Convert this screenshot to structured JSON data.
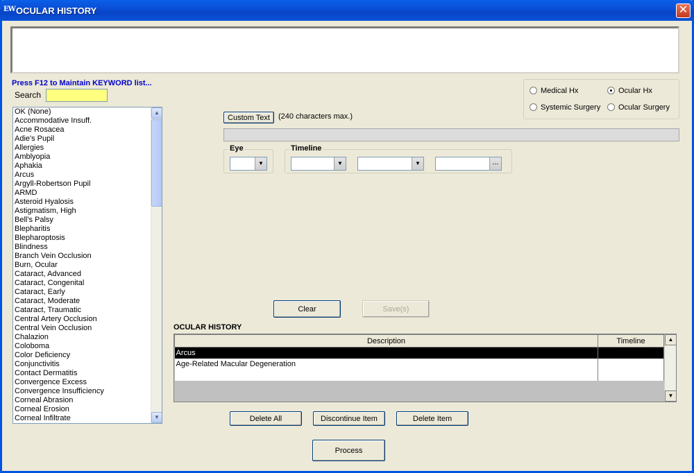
{
  "window": {
    "app_logo": "EW",
    "title": "OCULAR HISTORY",
    "close_glyph": "✕"
  },
  "hint": "Press F12 to Maintain KEYWORD list...",
  "search": {
    "label": "Search",
    "value": ""
  },
  "keywords": [
    "OK (None)",
    "Accommodative Insuff.",
    "Acne Rosacea",
    "Adie's Pupil",
    "Allergies",
    "Amblyopia",
    "Aphakia",
    "Arcus",
    "Argyll-Robertson Pupil",
    "ARMD",
    "Asteroid Hyalosis",
    "Astigmatism, High",
    "Bell's Palsy",
    "Blepharitis",
    "Blepharoptosis",
    "Blindness",
    "Branch Vein Occlusion",
    "Burn, Ocular",
    "Cataract, Advanced",
    "Cataract, Congenital",
    "Cataract, Early",
    "Cataract, Moderate",
    "Cataract, Traumatic",
    "Central Artery Occlusion",
    "Central Vein Occlusion",
    "Chalazion",
    "Coloboma",
    "Color Deficiency",
    "Conjunctivitis",
    "Contact Dermatitis",
    "Convergence Excess",
    "Convergence Insufficiency",
    "Corneal Abrasion",
    "Corneal Erosion",
    "Corneal Infiltrate"
  ],
  "history_type": {
    "options": [
      "Medical Hx",
      "Ocular Hx",
      "Systemic Surgery",
      "Ocular Surgery"
    ],
    "selected": "Ocular Hx"
  },
  "custom_text": {
    "button": "Custom Text",
    "note": "(240 characters max.)",
    "value": ""
  },
  "eye": {
    "label": "Eye",
    "value": ""
  },
  "timeline": {
    "label": "Timeline",
    "value1": "",
    "value2": "",
    "value3": "",
    "browse": "..."
  },
  "actions": {
    "clear": "Clear",
    "save": "Save(s)"
  },
  "ocular_history": {
    "title": "OCULAR HISTORY",
    "columns": [
      "Description",
      "Timeline"
    ],
    "rows": [
      {
        "description": "Arcus",
        "timeline": ""
      },
      {
        "description": "Age-Related Macular Degeneration",
        "timeline": ""
      }
    ],
    "selected_row": 0
  },
  "bottom_buttons": {
    "delete_all": "Delete All",
    "discontinue": "Discontinue Item",
    "delete_item": "Delete Item",
    "process": "Process"
  },
  "icons": {
    "scroll_up": "▲",
    "scroll_down": "▼",
    "dropdown": "▼"
  }
}
